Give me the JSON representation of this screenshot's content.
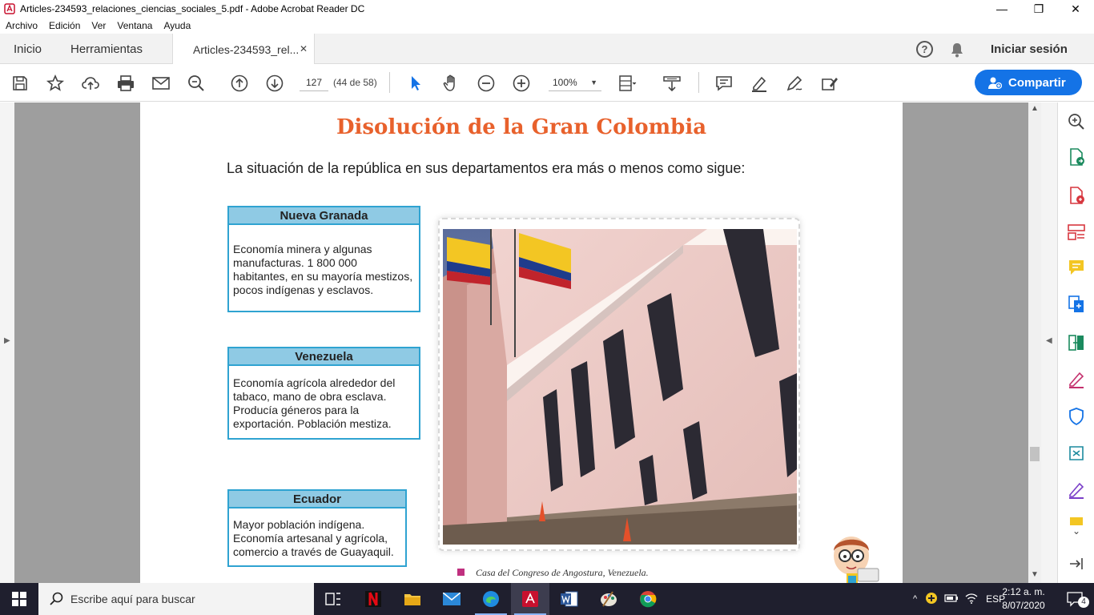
{
  "window": {
    "title": "Articles-234593_relaciones_ciencias_sociales_5.pdf - Adobe Acrobat Reader DC",
    "minimize": "—",
    "maximize": "❐",
    "close": "✕"
  },
  "menu": [
    "Archivo",
    "Edición",
    "Ver",
    "Ventana",
    "Ayuda"
  ],
  "tabs": {
    "home": "Inicio",
    "tools": "Herramientas",
    "document": "Articles-234593_rel...",
    "sign_in": "Iniciar sesión"
  },
  "toolbar": {
    "page_number": "127",
    "page_count": "(44 de 58)",
    "zoom": "100%",
    "share_label": "Compartir"
  },
  "page": {
    "title": "Disolución de la Gran Colombia",
    "subtitle": "La situación de la república en sus departamentos era más o menos como sigue:",
    "boxes": [
      {
        "heading": "Nueva Granada",
        "text": "Economía minera y algunas manufacturas. 1 800 000 habitantes, en su mayoría mestizos, pocos indígenas y esclavos."
      },
      {
        "heading": "Venezuela",
        "text": "Economía agrícola alrededor del tabaco, mano de obra esclava. Producía géneros para la exportación. Población mestiza."
      },
      {
        "heading": "Ecuador",
        "text": "Mayor población indígena. Economía artesanal y agrícola, comercio a través de Guayaquil."
      }
    ],
    "caption": "Casa del Congreso de Angostura, Venezuela."
  },
  "taskbar": {
    "search_placeholder": "Escribe aquí para buscar",
    "language": "ESP",
    "time": "2:12 a. m.",
    "date": "8/07/2020",
    "notifications": "4"
  },
  "colors": {
    "title_orange": "#e8612c",
    "box_border": "#2fa3d1",
    "box_header": "#8fcae4",
    "share_blue": "#1473e6"
  }
}
